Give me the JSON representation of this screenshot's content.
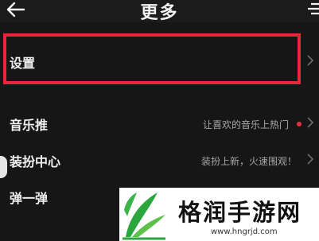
{
  "header": {
    "title": "更多",
    "back_icon": "back-arrow-icon",
    "right_icon": "menu-icon"
  },
  "rows": [
    {
      "label": "设置",
      "sub": "",
      "dot": false
    },
    {
      "label": "音乐推",
      "sub": "让喜欢的音乐上热门",
      "dot": true
    },
    {
      "label": "装扮中心",
      "sub": "装扮上新，火速围观！",
      "dot": false
    },
    {
      "label": "弹一弹",
      "sub": "",
      "dot": false
    }
  ],
  "watermark": {
    "title": "格润手游网",
    "url": "www.hngrjd.com"
  },
  "colors": {
    "background": "#161616",
    "highlight": "#e8253a",
    "dot": "#e8323c",
    "logo_green": "#2aa63c"
  }
}
